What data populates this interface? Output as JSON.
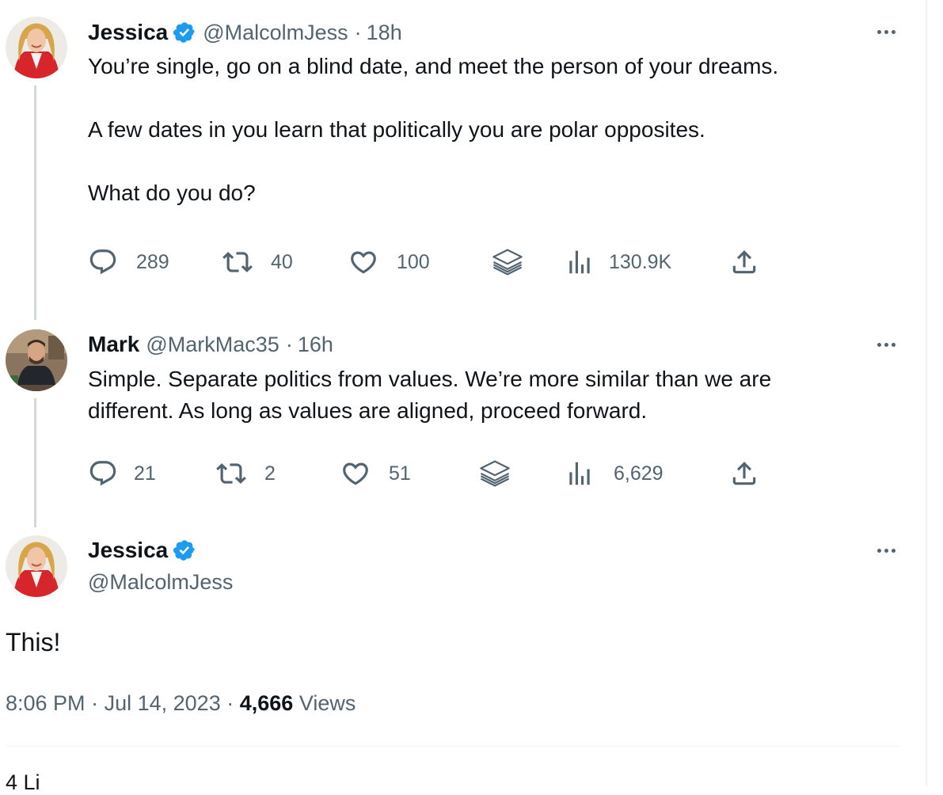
{
  "thread": [
    {
      "author": "Jessica",
      "handle": "@MalcolmJess",
      "separator": "·",
      "time": "18h",
      "verified": true,
      "text": "You’re single, go on a blind date, and meet the person of your dreams.\n\nA few dates in you learn that politically you are polar opposites.\n\nWhat do you do?",
      "stats": {
        "replies": "289",
        "reposts": "40",
        "likes": "100",
        "views": "130.9K"
      },
      "icons": [
        "reply-icon",
        "repost-icon",
        "like-icon",
        "bookmark-stack-icon",
        "views-chart-icon",
        "share-icon"
      ]
    },
    {
      "author": "Mark",
      "handle": "@MarkMac35",
      "separator": "·",
      "time": "16h",
      "verified": false,
      "text": "Simple. Separate politics from values. We’re more similar than we are\ndifferent. As long as values are aligned, proceed forward.",
      "stats": {
        "replies": "21",
        "reposts": "2",
        "likes": "51",
        "views": "6,629"
      }
    }
  ],
  "focus": {
    "author": "Jessica",
    "handle": "@MalcolmJess",
    "verified": true,
    "text": "This!",
    "time": "8:06 PM",
    "separator": "·",
    "date": "Jul 14, 2023",
    "views_count": "4,666",
    "views_label": "Views",
    "cut_off_text": "4 Li"
  },
  "colors": {
    "text": "#0f1419",
    "secondary": "#536471",
    "verified": "#1d9bf0",
    "thread_line": "#cfd9de",
    "divider": "#eff3f4"
  }
}
